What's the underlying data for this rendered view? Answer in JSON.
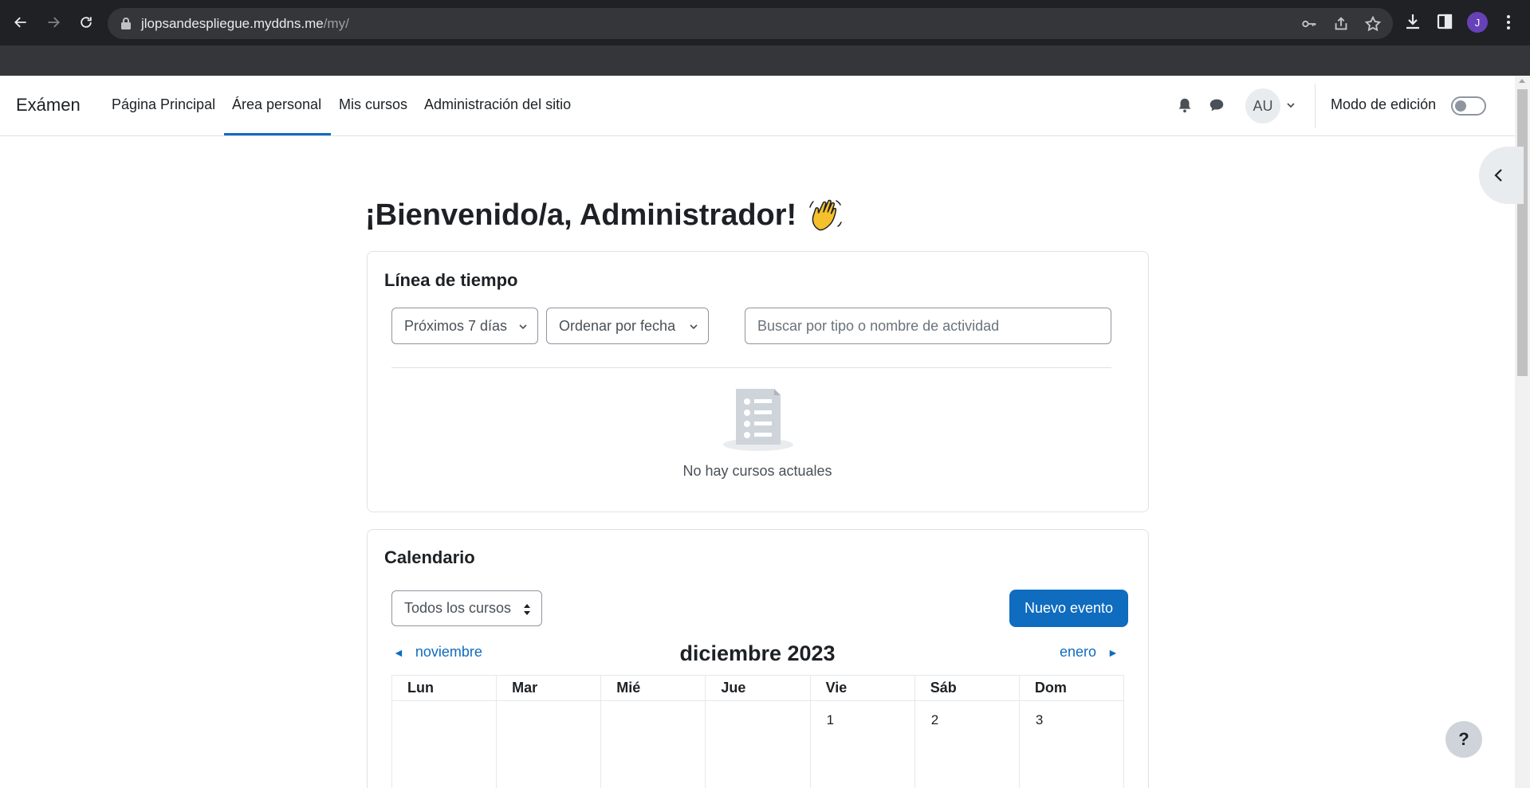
{
  "browser": {
    "url_host": "jlopsandespliegue.myddns.me",
    "url_path": "/my/",
    "profile_initial": "J"
  },
  "navbar": {
    "site_name": "Exámen",
    "links": [
      "Página Principal",
      "Área personal",
      "Mis cursos",
      "Administración del sitio"
    ],
    "active_link": "Área personal",
    "avatar_initials": "AU",
    "edit_mode_label": "Modo de edición",
    "edit_mode_on": false
  },
  "page": {
    "welcome": "¡Bienvenido/a, Administrador!"
  },
  "timeline": {
    "title": "Línea de tiempo",
    "filter_label": "Próximos 7 días",
    "sort_label": "Ordenar por fecha",
    "search_placeholder": "Buscar por tipo o nombre de actividad",
    "empty_text": "No hay cursos actuales"
  },
  "calendar": {
    "title": "Calendario",
    "course_select": "Todos los cursos",
    "new_event_label": "Nuevo evento",
    "prev_month": "noviembre",
    "next_month": "enero",
    "month_title": "diciembre 2023",
    "weekdays": [
      "Lun",
      "Mar",
      "Mié",
      "Jue",
      "Vie",
      "Sáb",
      "Dom"
    ],
    "first_week": [
      "",
      "",
      "",
      "",
      "1",
      "2",
      "3"
    ]
  },
  "help_label": "?"
}
